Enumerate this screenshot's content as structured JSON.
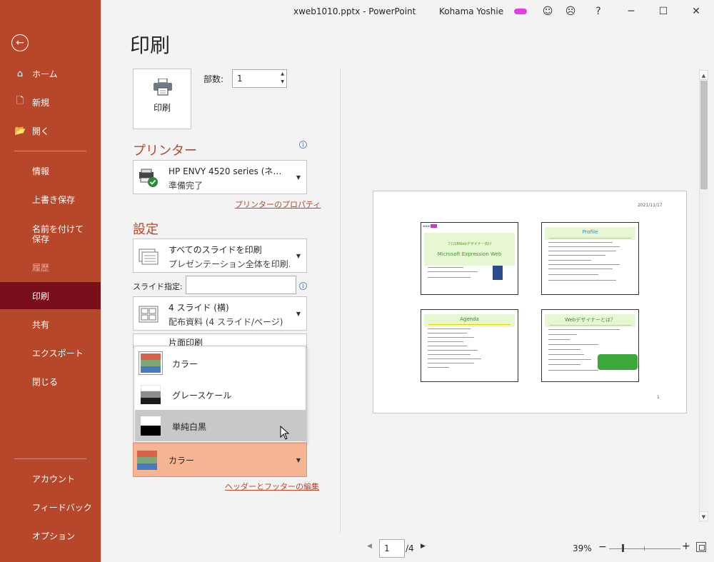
{
  "titlebar": {
    "title": "xweb1010.pptx  -  PowerPoint",
    "user": "Kohama Yoshie",
    "help": "?",
    "minimize": "─",
    "maximize": "☐",
    "close": "✕"
  },
  "sidebar": {
    "back": "←",
    "items": [
      {
        "label": "ホーム",
        "icon": "⌂"
      },
      {
        "label": "新規",
        "icon": "🗋"
      },
      {
        "label": "開く",
        "icon": "📂"
      },
      {
        "label": "情報"
      },
      {
        "label": "上書き保存"
      },
      {
        "label": "名前を付けて保存"
      },
      {
        "label": "履歴"
      },
      {
        "label": "印刷"
      },
      {
        "label": "共有"
      },
      {
        "label": "エクスポート"
      },
      {
        "label": "閉じる"
      },
      {
        "label": "アカウント"
      },
      {
        "label": "フィードバック"
      },
      {
        "label": "オプション"
      }
    ]
  },
  "page_title": "印刷",
  "print_button": "印刷",
  "copies": {
    "label": "部数:",
    "value": "1"
  },
  "printer": {
    "heading": "プリンター",
    "name": "HP ENVY 4520 series (ネ…",
    "status": "準備完了",
    "properties_link": "プリンターのプロパティ"
  },
  "settings": {
    "heading": "設定",
    "scope": {
      "title": "すべてのスライドを印刷",
      "desc": "プレゼンテーション全体を印刷…"
    },
    "slide_spec_label": "スライド指定:",
    "layout": {
      "title": "4 スライド (横)",
      "desc": "配布資料 (4 スライド/ページ)"
    },
    "sides": {
      "title": "片面印刷"
    },
    "color_menu": [
      {
        "label": "カラー"
      },
      {
        "label": "グレースケール"
      },
      {
        "label": "単純白黒"
      }
    ],
    "color_selected": "カラー",
    "header_footer_link": "ヘッダーとフッターの編集"
  },
  "preview": {
    "date": "2021/11/17",
    "page_number": "1",
    "thumbs": [
      {
        "title": "フロSBWebデザイナー向け",
        "subtitle": "Microsoft Expression Web"
      },
      {
        "title": "Profile"
      },
      {
        "title": "Agenda"
      },
      {
        "title": "Webデザイナーとは？"
      }
    ]
  },
  "pager": {
    "current": "1",
    "total": "/4"
  },
  "zoom": {
    "value": "39%",
    "minus": "−",
    "plus": "+"
  },
  "colors": {
    "accent": "#b7472a",
    "active_nav": "#7a0f1c",
    "selected_dropdown": "#f5b493"
  }
}
